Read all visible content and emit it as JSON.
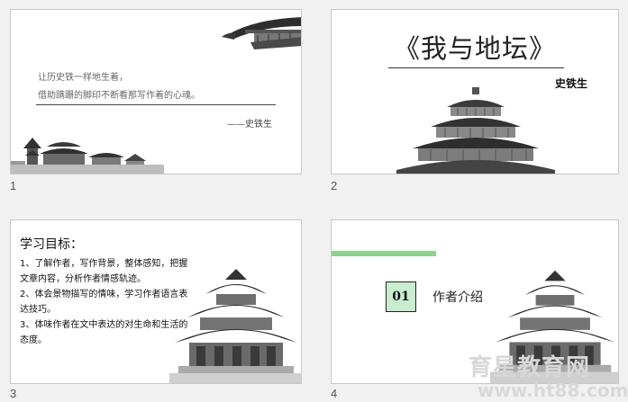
{
  "slides": [
    {
      "number": "1",
      "lines": [
        "让历史铁一样地生着，",
        "借助蹒跚的脚印不断看那写作着的心魂。"
      ],
      "signature": "——史铁生"
    },
    {
      "number": "2",
      "title": "《我与地坛》",
      "author": "史铁生"
    },
    {
      "number": "3",
      "heading": "学习目标：",
      "items": [
        "1、了解作者，写作背景，整体感知，把握文章内容，分析作者情感轨迹。",
        "2、体会景物描写的情味，学习作者语言表达技巧。",
        "3、体味作者在文中表达的对生命和生活的态度。"
      ]
    },
    {
      "number": "4",
      "section_number": "01",
      "section_label": "作者介绍"
    }
  ],
  "watermark": {
    "top": "育星教育网",
    "bottom": "www.ht88.com"
  },
  "colors": {
    "accent_bar": "#8fd18f",
    "box_fill": "#c9edcf"
  }
}
